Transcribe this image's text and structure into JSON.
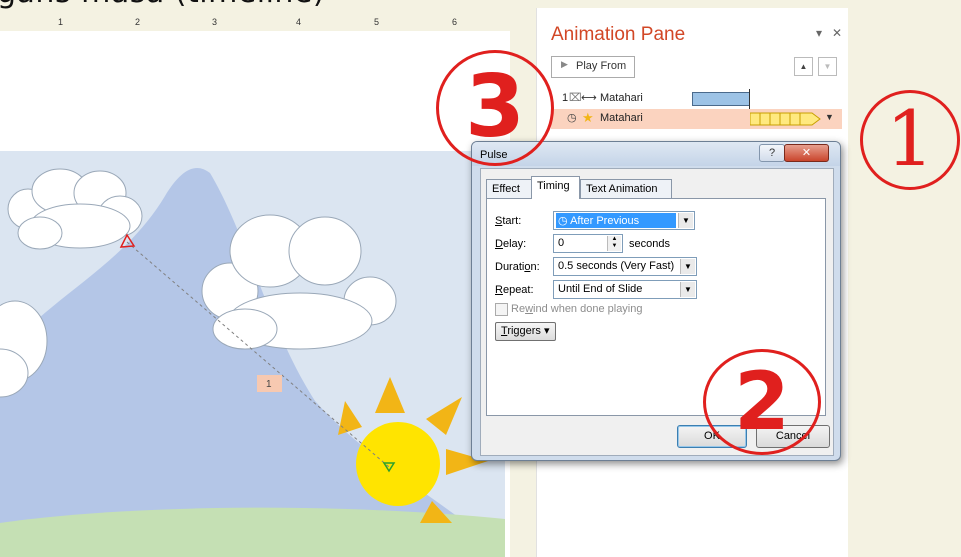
{
  "caption": "gans masa (timeline)",
  "ruler": {
    "numbers": [
      "1",
      "2",
      "3",
      "4",
      "5",
      "6"
    ]
  },
  "slide": {
    "anim_tag": "1"
  },
  "animation_pane": {
    "title": "Animation Pane",
    "dropdown_glyph": "▾",
    "close_glyph": "✕",
    "play_from_label": "Play From",
    "move_up_glyph": "▲",
    "move_down_glyph": "▼",
    "rows": [
      {
        "number": "1",
        "name": "Matahari"
      },
      {
        "name": "Matahari"
      }
    ]
  },
  "dialog": {
    "title": "Pulse",
    "help_glyph": "?",
    "close_glyph": "✕",
    "tabs": [
      "Effect",
      "Timing",
      "Text Animation"
    ],
    "active_tab": "Timing",
    "start": {
      "label_u": "S",
      "label_rest": "tart:",
      "value": "After Previous"
    },
    "delay": {
      "label_u": "D",
      "label_rest": "elay:",
      "value": "0",
      "unit": "seconds"
    },
    "duration": {
      "label_pre": "Durati",
      "label_u": "o",
      "label_rest": "n:",
      "value": "0.5 seconds (Very Fast)"
    },
    "repeat": {
      "label_u": "R",
      "label_rest": "epeat:",
      "value": "Until End of Slide"
    },
    "rewind": {
      "pre": "Re",
      "u": "w",
      "rest": "ind when done playing",
      "checked": false
    },
    "triggers": {
      "u": "T",
      "rest": "riggers"
    },
    "ok_label": "OK",
    "cancel_label": "Cancel"
  },
  "callouts": [
    {
      "number": "1",
      "color": "#e0201e"
    },
    {
      "number": "2",
      "color": "#e0201e"
    },
    {
      "number": "3",
      "color": "#e0201e"
    }
  ],
  "colors": {
    "accent_title": "#d24726",
    "selected_row": "#fbd3bf",
    "slide_bg": "#dbe5f1",
    "mountain": "#b4c6e7",
    "hill": "#c5e0b4",
    "sun": "#ffe400",
    "sun_ray": "#f2b516",
    "timeline_bar": "#9dc3e6",
    "timeline_selected": "#ffe97f"
  },
  "icons": {
    "play": "triangle-right-icon",
    "mouse_click": "mouse-click-icon",
    "motion_path": "motion-path-icon",
    "clock": "clock-icon",
    "emphasis": "star-icon",
    "dropdown": "chevron-down-icon",
    "triggers_expand": "double-chevron-down-icon",
    "spinner": "spinner-arrows-icon"
  }
}
